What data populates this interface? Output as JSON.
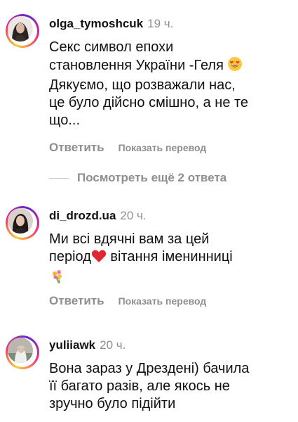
{
  "comments": [
    {
      "username": "olga_tymoshcuk",
      "time": "19 ч.",
      "lines": [
        "Секс символ епохи",
        "становлення України -Геля",
        "Дякуємо, що розважали нас,",
        "це було дійсно смішно, а не те",
        "що..."
      ],
      "emoji_after_line": 1,
      "emoji": "heart-eyes-icon",
      "reply_label": "Ответить",
      "translate_label": "Показать перевод"
    },
    {
      "username": "di_drozd.ua",
      "time": "20 ч.",
      "line1": "Ми всі вдячні вам за цей",
      "line2_before": "період",
      "line2_after": " вітання іменинниці",
      "emoji_heart": "red-heart-icon",
      "emoji_bouquet": "bouquet-icon",
      "reply_label": "Ответить",
      "translate_label": "Показать перевод"
    },
    {
      "username": "yuliiawk",
      "time": "20 ч.",
      "lines": [
        "Вона зараз у Дрездені) бачила",
        "її багато разів, але якось не",
        "зручно було підійти"
      ]
    }
  ],
  "more_replies": "Посмотреть ещё 2 ответа",
  "colors": {
    "secondary_text": "#8e8e8e",
    "text": "#111111",
    "story_ring": "#ee2a7b"
  }
}
